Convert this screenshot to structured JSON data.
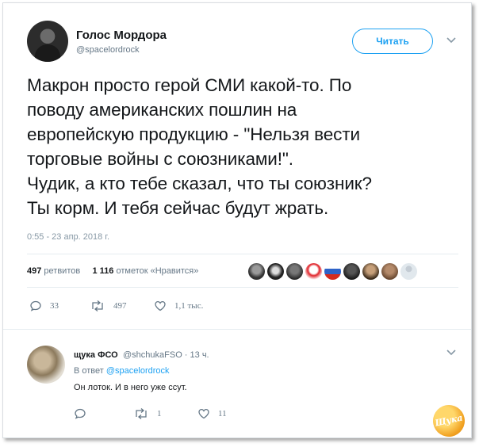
{
  "tweet": {
    "display_name": "Голос Мордора",
    "handle": "@spacelordrock",
    "follow_label": "Читать",
    "text": "Макрон просто герой СМИ какой-то. По\nповоду американских пошлин на\nевропейскую продукцию - \"Нельзя вести\nторговые войны с союзниками!\".\nЧудик, а кто тебе сказал, что ты союзник?\nТы корм. И тебя сейчас будут жрать.",
    "timestamp": "0:55 - 23 апр. 2018 г.",
    "stats": {
      "retweets_count": "497",
      "retweets_label": "ретвитов",
      "likes_count": "1 116",
      "likes_label": "отметок «Нравится»"
    },
    "actions": {
      "replies": "33",
      "retweets": "497",
      "likes": "1,1 тыс."
    }
  },
  "reply": {
    "display_name": "щука ФСО",
    "handle": "@shchukaFSO · 13 ч.",
    "reply_to_prefix": "В ответ",
    "reply_to_handle": "@spacelordrock",
    "text": "Он лоток. И в него уже ссут.",
    "actions": {
      "retweets": "1",
      "likes": "11"
    }
  },
  "watermark": "Щука",
  "colors": {
    "accent": "#1da1f2",
    "muted": "#657786",
    "text": "#14171a",
    "divider": "#e6ecf0"
  }
}
